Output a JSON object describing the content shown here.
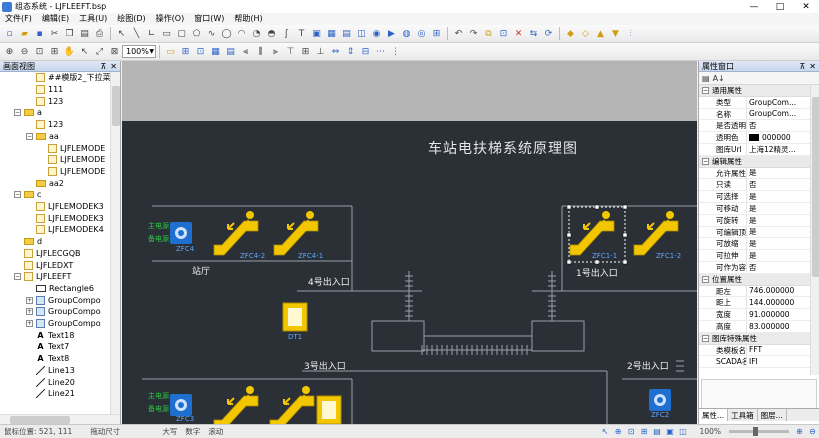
{
  "window": {
    "title": "组态系统 - LJFLEEFT.bsp",
    "controls": [
      "—",
      "□",
      "✕"
    ]
  },
  "menu": [
    "文件(F)",
    "编辑(E)",
    "工具(U)",
    "绘图(D)",
    "操作(O)",
    "窗口(W)",
    "帮助(H)"
  ],
  "toolbar": {
    "zoom": "100%"
  },
  "left_panel": {
    "title": "画面视图",
    "tree": [
      {
        "label": "##模版2_下拉菜单",
        "indent": 2,
        "icon": "page",
        "exp": ""
      },
      {
        "label": "111",
        "indent": 2,
        "icon": "page",
        "exp": ""
      },
      {
        "label": "123",
        "indent": 2,
        "icon": "page",
        "exp": ""
      },
      {
        "label": "a",
        "indent": 1,
        "icon": "folder",
        "exp": "−"
      },
      {
        "label": "123",
        "indent": 2,
        "icon": "page",
        "exp": ""
      },
      {
        "label": "aa",
        "indent": 2,
        "icon": "folder",
        "exp": "−"
      },
      {
        "label": "LJFLEMODE",
        "indent": 3,
        "icon": "page",
        "exp": ""
      },
      {
        "label": "LJFLEMODE",
        "indent": 3,
        "icon": "page",
        "exp": ""
      },
      {
        "label": "LJFLEMODE",
        "indent": 3,
        "icon": "page",
        "exp": ""
      },
      {
        "label": "aa2",
        "indent": 2,
        "icon": "folder",
        "exp": ""
      },
      {
        "label": "c",
        "indent": 1,
        "icon": "folder",
        "exp": "−"
      },
      {
        "label": "LJFLEMODEK3",
        "indent": 2,
        "icon": "page",
        "exp": ""
      },
      {
        "label": "LJFLEMODEK3",
        "indent": 2,
        "icon": "page",
        "exp": ""
      },
      {
        "label": "LJFLEMODEK4",
        "indent": 2,
        "icon": "page",
        "exp": ""
      },
      {
        "label": "d",
        "indent": 1,
        "icon": "folder",
        "exp": ""
      },
      {
        "label": "LJFLECGQB",
        "indent": 1,
        "icon": "page",
        "exp": ""
      },
      {
        "label": "LJFLEDXT",
        "indent": 1,
        "icon": "page",
        "exp": ""
      },
      {
        "label": "LJFLEEFT",
        "indent": 1,
        "icon": "page",
        "exp": "−"
      },
      {
        "label": "Rectangle6",
        "indent": 2,
        "icon": "rect",
        "exp": ""
      },
      {
        "label": "GroupCompo",
        "indent": 2,
        "icon": "group",
        "exp": "+"
      },
      {
        "label": "GroupCompo",
        "indent": 2,
        "icon": "group",
        "exp": "+"
      },
      {
        "label": "GroupCompo",
        "indent": 2,
        "icon": "group",
        "exp": "+"
      },
      {
        "label": "Text18",
        "indent": 2,
        "icon": "text",
        "exp": ""
      },
      {
        "label": "Text7",
        "indent": 2,
        "icon": "text",
        "exp": ""
      },
      {
        "label": "Text8",
        "indent": 2,
        "icon": "text",
        "exp": ""
      },
      {
        "label": "Line13",
        "indent": 2,
        "icon": "line",
        "exp": ""
      },
      {
        "label": "Line20",
        "indent": 2,
        "icon": "line",
        "exp": ""
      },
      {
        "label": "Line21",
        "indent": 2,
        "icon": "line",
        "exp": ""
      }
    ]
  },
  "canvas": {
    "title": "车站电扶梯系统原理图",
    "labels": {
      "hall": "站厅",
      "exit4": "4号出入口",
      "exit1": "1号出入口",
      "exit3": "3号出入口",
      "exit2": "2号出入口"
    },
    "devices": {
      "zfc4": "ZFC4",
      "zfc4_2": "ZFC4-2",
      "zfc4_1": "ZFC4-1",
      "zfc1_1": "ZFC1-1",
      "zfc1_2": "ZFC1-2",
      "dt1": "DT1",
      "zfc3": "ZFC3",
      "zfc2": "ZFC2"
    },
    "status_top": [
      "主电源",
      "备电源"
    ],
    "status_bottom": [
      "主电源",
      "备电源"
    ]
  },
  "right_panel": {
    "title": "属性窗口",
    "sections": [
      {
        "name": "通用属性",
        "rows": [
          [
            "类型",
            "GroupCom..."
          ],
          [
            "名称",
            "GroupCom..."
          ],
          [
            "是否透明",
            "否"
          ],
          [
            "透明色",
            "000000"
          ],
          [
            "图库Url",
            "上海12精灵..."
          ]
        ]
      },
      {
        "name": "编辑属性",
        "rows": [
          [
            "允许属性改...",
            "是"
          ],
          [
            "只读",
            "否"
          ],
          [
            "可选择",
            "是"
          ],
          [
            "可移动",
            "是"
          ],
          [
            "可旋转",
            "是"
          ],
          [
            "可编辑顶点",
            "是"
          ],
          [
            "可放缩",
            "是"
          ],
          [
            "可拉伸",
            "是"
          ],
          [
            "可作为容器",
            "否"
          ]
        ]
      },
      {
        "name": "位置属性",
        "rows": [
          [
            "距左",
            "746.000000"
          ],
          [
            "距上",
            "144.000000"
          ],
          [
            "宽度",
            "91.000000"
          ],
          [
            "高度",
            "83.000000"
          ]
        ]
      },
      {
        "name": "图库特殊属性",
        "rows": [
          [
            "类模板名",
            "FFT"
          ],
          [
            "SCADA名",
            "IFI"
          ]
        ]
      }
    ],
    "tabs": [
      "属性...",
      "工具箱",
      "图层..."
    ]
  },
  "status": {
    "coords": "鼠标位置: 521, 111",
    "size": "拖动尺寸",
    "caps": "大写",
    "num": "数字",
    "scroll": "滚动",
    "zoom": "100%"
  },
  "colors": {
    "canvas_bg": "#2b2f36",
    "outer_bg": "#b4b4b4",
    "escalator": "#f2c700",
    "device_blue": "#1f6fd0",
    "label_blue": "#5aa8ff",
    "status_green": "#31c44a"
  }
}
